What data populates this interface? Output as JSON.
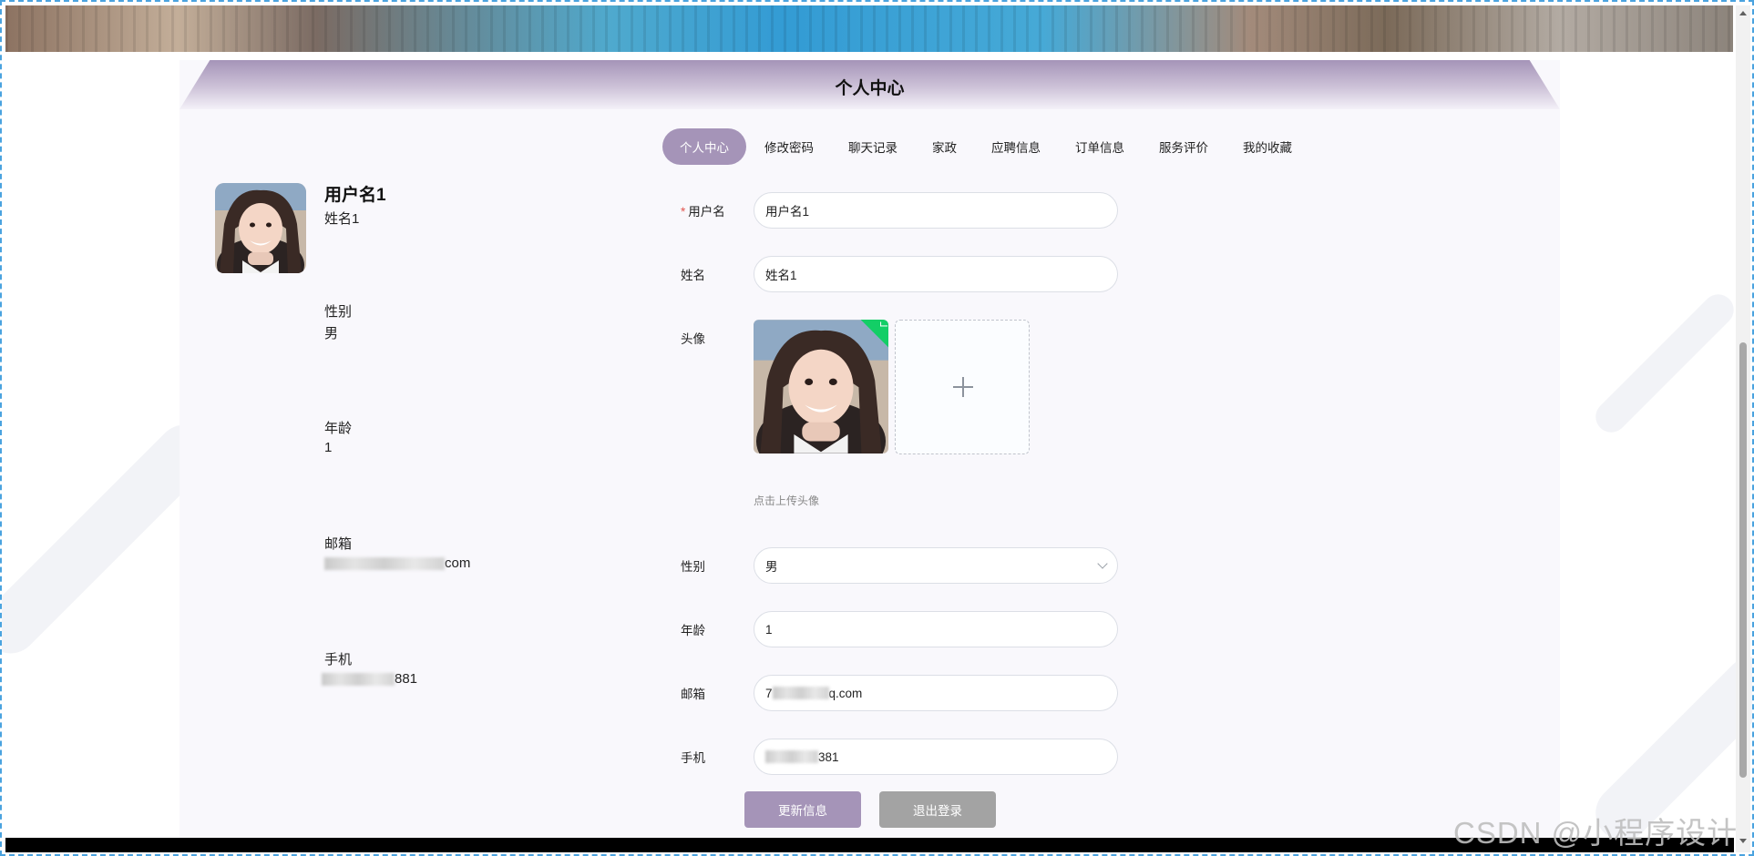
{
  "header": {
    "title": "个人中心"
  },
  "tabs": [
    {
      "label": "个人中心",
      "active": true
    },
    {
      "label": "修改密码"
    },
    {
      "label": "聊天记录"
    },
    {
      "label": "家政"
    },
    {
      "label": "应聘信息"
    },
    {
      "label": "订单信息"
    },
    {
      "label": "服务评价"
    },
    {
      "label": "我的收藏"
    }
  ],
  "profile": {
    "username": "用户名1",
    "realname": "姓名1",
    "gender_label": "性别",
    "gender_value": "男",
    "age_label": "年龄",
    "age_value": "1",
    "email_label": "邮箱",
    "email_value_suffix": "com",
    "phone_label": "手机",
    "phone_value_suffix": "881"
  },
  "form": {
    "username_label": "用户名",
    "username_value": "用户名1",
    "realname_label": "姓名",
    "realname_value": "姓名1",
    "avatar_label": "头像",
    "upload_tip": "点击上传头像",
    "gender_label": "性别",
    "gender_value": "男",
    "age_label": "年龄",
    "age_value": "1",
    "email_label": "邮箱",
    "email_prefix": "7",
    "email_suffix": "q.com",
    "phone_label": "手机",
    "phone_suffix": "381"
  },
  "buttons": {
    "update": "更新信息",
    "logout": "退出登录"
  },
  "watermark": "CSDN @小程序设计",
  "colors": {
    "accent": "#a594b8",
    "success": "#13ce66",
    "logout": "#a3a3a3"
  }
}
